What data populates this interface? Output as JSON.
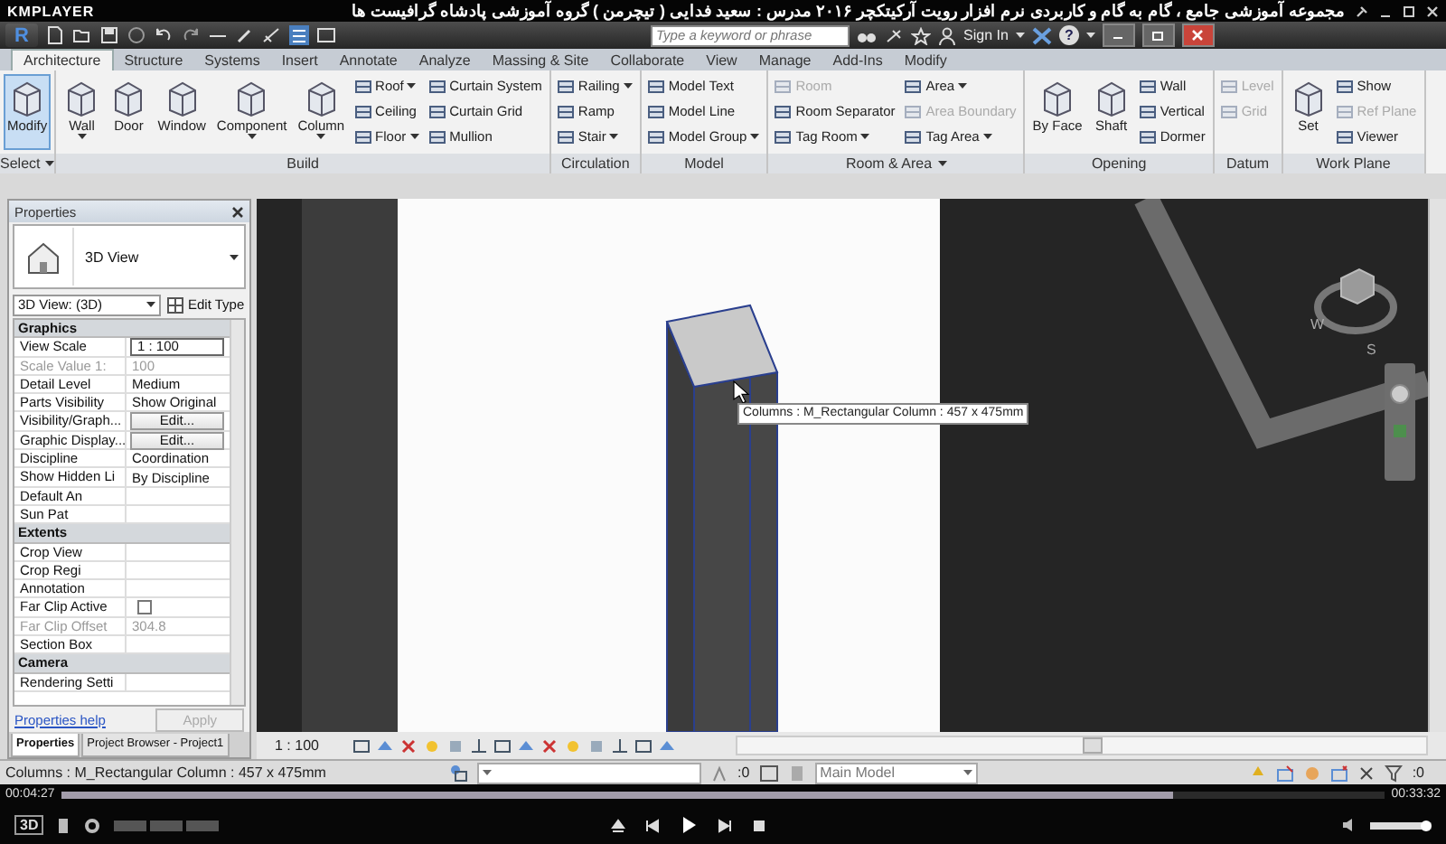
{
  "player": {
    "app_name": "KMPLAYER",
    "video_title": "مجموعه آموزشی جامع ، گام به گام و کاربردی نرم افزار رویت آرکیتکچر ۲۰۱۶   مدرس : سعید فدایی ( تیچرمن ) گروه آموزشی پادشاه گرافیست ها",
    "elapsed": "00:04:27",
    "total": "00:33:32",
    "progress": {
      "level": 0.84
    },
    "volume": {
      "level": 0.9
    },
    "badge": "3D"
  },
  "revit": {
    "logo": "R",
    "search": {
      "placeholder": "Type a keyword or phrase"
    },
    "sign_in": "Sign In",
    "help": "?",
    "tabs": [
      {
        "label": "Architecture",
        "selected": true
      },
      {
        "label": "Structure",
        "selected": false
      },
      {
        "label": "Systems",
        "selected": false
      },
      {
        "label": "Insert",
        "selected": false
      },
      {
        "label": "Annotate",
        "selected": false
      },
      {
        "label": "Analyze",
        "selected": false
      },
      {
        "label": "Massing & Site",
        "selected": false
      },
      {
        "label": "Collaborate",
        "selected": false
      },
      {
        "label": "View",
        "selected": false
      },
      {
        "label": "Manage",
        "selected": false
      },
      {
        "label": "Add-Ins",
        "selected": false
      },
      {
        "label": "Modify",
        "selected": false
      }
    ],
    "panels": [
      {
        "label": "Select",
        "dropdown": true,
        "tools": [
          {
            "label": "Modify",
            "kind": "large",
            "selected": true,
            "disabled": false,
            "dropdown": false
          }
        ]
      },
      {
        "label": "Build",
        "dropdown": false,
        "tools": [
          {
            "label": "Wall",
            "kind": "large",
            "selected": false,
            "disabled": false,
            "dropdown": true
          },
          {
            "label": "Door",
            "kind": "large",
            "selected": false,
            "disabled": false,
            "dropdown": false
          },
          {
            "label": "Window",
            "kind": "large",
            "selected": false,
            "disabled": false,
            "dropdown": false
          },
          {
            "label": "Component",
            "kind": "large",
            "selected": false,
            "disabled": false,
            "dropdown": true
          },
          {
            "label": "Column",
            "kind": "large",
            "selected": false,
            "disabled": false,
            "dropdown": true
          },
          {
            "label": "Roof",
            "kind": "small",
            "selected": false,
            "disabled": false,
            "dropdown": true
          },
          {
            "label": "Ceiling",
            "kind": "small",
            "selected": false,
            "disabled": false,
            "dropdown": false
          },
          {
            "label": "Floor",
            "kind": "small",
            "selected": false,
            "disabled": false,
            "dropdown": true
          },
          {
            "label": "Curtain System",
            "kind": "small",
            "selected": false,
            "disabled": false,
            "dropdown": false
          },
          {
            "label": "Curtain Grid",
            "kind": "small",
            "selected": false,
            "disabled": false,
            "dropdown": false
          },
          {
            "label": "Mullion",
            "kind": "small",
            "selected": false,
            "disabled": false,
            "dropdown": false
          }
        ]
      },
      {
        "label": "Circulation",
        "dropdown": false,
        "tools": [
          {
            "label": "Railing",
            "kind": "small",
            "selected": false,
            "disabled": false,
            "dropdown": true
          },
          {
            "label": "Ramp",
            "kind": "small",
            "selected": false,
            "disabled": false,
            "dropdown": false
          },
          {
            "label": "Stair",
            "kind": "small",
            "selected": false,
            "disabled": false,
            "dropdown": true
          }
        ]
      },
      {
        "label": "Model",
        "dropdown": false,
        "tools": [
          {
            "label": "Model Text",
            "kind": "small",
            "selected": false,
            "disabled": false,
            "dropdown": false
          },
          {
            "label": "Model Line",
            "kind": "small",
            "selected": false,
            "disabled": false,
            "dropdown": false
          },
          {
            "label": "Model Group",
            "kind": "small",
            "selected": false,
            "disabled": false,
            "dropdown": true
          }
        ]
      },
      {
        "label": "Room & Area",
        "dropdown": true,
        "tools": [
          {
            "label": "Room",
            "kind": "small",
            "selected": false,
            "disabled": true,
            "dropdown": false
          },
          {
            "label": "Room Separator",
            "kind": "small",
            "selected": false,
            "disabled": false,
            "dropdown": false
          },
          {
            "label": "Tag Room",
            "kind": "small",
            "selected": false,
            "disabled": false,
            "dropdown": true
          },
          {
            "label": "Area",
            "kind": "small",
            "selected": false,
            "disabled": false,
            "dropdown": true
          },
          {
            "label": "Area Boundary",
            "kind": "small",
            "selected": false,
            "disabled": true,
            "dropdown": false
          },
          {
            "label": "Tag Area",
            "kind": "small",
            "selected": false,
            "disabled": false,
            "dropdown": true
          }
        ]
      },
      {
        "label": "Opening",
        "dropdown": false,
        "tools": [
          {
            "label": "By Face",
            "kind": "large",
            "selected": false,
            "disabled": false,
            "dropdown": false
          },
          {
            "label": "Shaft",
            "kind": "large",
            "selected": false,
            "disabled": false,
            "dropdown": false
          },
          {
            "label": "Wall",
            "kind": "small",
            "selected": false,
            "disabled": false,
            "dropdown": false
          },
          {
            "label": "Vertical",
            "kind": "small",
            "selected": false,
            "disabled": false,
            "dropdown": false
          },
          {
            "label": "Dormer",
            "kind": "small",
            "selected": false,
            "disabled": false,
            "dropdown": false
          }
        ]
      },
      {
        "label": "Datum",
        "dropdown": false,
        "tools": [
          {
            "label": "Level",
            "kind": "small",
            "selected": false,
            "disabled": true,
            "dropdown": false
          },
          {
            "label": "Grid",
            "kind": "small",
            "selected": false,
            "disabled": true,
            "dropdown": false
          }
        ]
      },
      {
        "label": "Work Plane",
        "dropdown": false,
        "tools": [
          {
            "label": "Set",
            "kind": "large",
            "selected": false,
            "disabled": false,
            "dropdown": false
          },
          {
            "label": "Show",
            "kind": "small",
            "selected": false,
            "disabled": false,
            "dropdown": false
          },
          {
            "label": "Ref Plane",
            "kind": "small",
            "selected": false,
            "disabled": true,
            "dropdown": false
          },
          {
            "label": "Viewer",
            "kind": "small",
            "selected": false,
            "disabled": false,
            "dropdown": false
          }
        ]
      }
    ]
  },
  "properties": {
    "title": "Properties",
    "type_name": "3D View",
    "selector": "3D View: (3D)",
    "edit_type": "Edit Type",
    "rows": [
      {
        "kind": "group",
        "label": "Graphics"
      },
      {
        "kind": "field",
        "label": "View Scale",
        "value": "1 : 100",
        "disabled": false
      },
      {
        "kind": "text",
        "label": "Scale Value    1:",
        "value": "100",
        "disabled": true
      },
      {
        "kind": "text",
        "label": "Detail Level",
        "value": "Medium",
        "disabled": false
      },
      {
        "kind": "text",
        "label": "Parts Visibility",
        "value": "Show Original",
        "disabled": false
      },
      {
        "kind": "button",
        "label": "Visibility/Graph...",
        "value": "Edit...",
        "disabled": false
      },
      {
        "kind": "button",
        "label": "Graphic Display...",
        "value": "Edit...",
        "disabled": false
      },
      {
        "kind": "text",
        "label": "Discipline",
        "value": "Coordination",
        "disabled": false
      },
      {
        "kind": "text",
        "label": "Show Hidden Li",
        "value": "By Discipline",
        "disabled": false
      },
      {
        "kind": "text",
        "label": "Default An",
        "disabled": false
      },
      {
        "kind": "text",
        "label": "Sun Pat",
        "disabled": false
      },
      {
        "kind": "group",
        "label": "Extents"
      },
      {
        "kind": "text",
        "label": "Crop View",
        "disabled": false
      },
      {
        "kind": "text",
        "label": "Crop Regi",
        "disabled": false
      },
      {
        "kind": "text",
        "label": "Annotation",
        "disabled": false
      },
      {
        "kind": "checkbox",
        "label": "Far Clip Active",
        "checked": false,
        "disabled": false
      },
      {
        "kind": "text",
        "label": "Far Clip Offset",
        "value": "304.8",
        "disabled": true
      },
      {
        "kind": "text",
        "label": "Section Box",
        "disabled": false
      },
      {
        "kind": "group",
        "label": "Camera"
      },
      {
        "kind": "text",
        "label": "Rendering Setti",
        "disabled": false
      }
    ],
    "help_link": "Properties help",
    "apply": {
      "label": "Apply",
      "disabled": true
    },
    "tabs": [
      {
        "label": "Properties",
        "selected": true
      },
      {
        "label": "Project Browser - Project1",
        "selected": false
      }
    ]
  },
  "view": {
    "scale": "1 : 100",
    "tooltip": "Columns : M_Rectangular Column : 457 x 475mm",
    "compass_labels": [
      "W",
      "S"
    ]
  },
  "status_bar": {
    "text": "Columns : M_Rectangular Column : 457 x 475mm",
    "selection_count": ":0",
    "workset": "Main Model",
    "filter_count": ":0"
  }
}
